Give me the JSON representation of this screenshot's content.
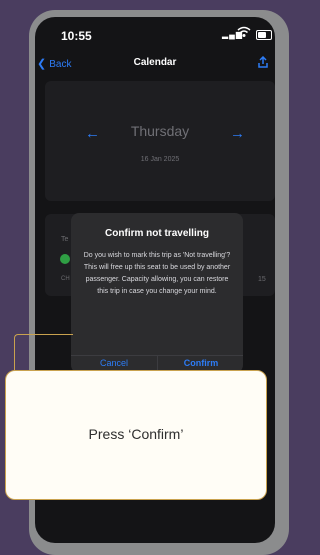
{
  "status_bar": {
    "time": "10:55"
  },
  "nav": {
    "back_label": "Back",
    "title": "Calendar"
  },
  "date_card": {
    "day": "Thursday",
    "date": "16 Jan 2025",
    "prev_arrow": "←",
    "next_arrow": "→"
  },
  "trip_card": {
    "label_fragment": "Te",
    "code_fragment": "CH",
    "number_fragment": "15"
  },
  "dialog": {
    "title": "Confirm not travelling",
    "message": "Do you wish to mark this trip as 'Not travelling'? This will free up this seat to be used by another passenger. Capacity allowing, you can restore this trip in case you change your mind.",
    "cancel_label": "Cancel",
    "confirm_label": "Confirm"
  },
  "callout": {
    "text": "Press ‘Confirm’"
  },
  "colors": {
    "background": "#4a3d5f",
    "accent": "#2d7cf6",
    "callout_border": "#c9a24f"
  }
}
